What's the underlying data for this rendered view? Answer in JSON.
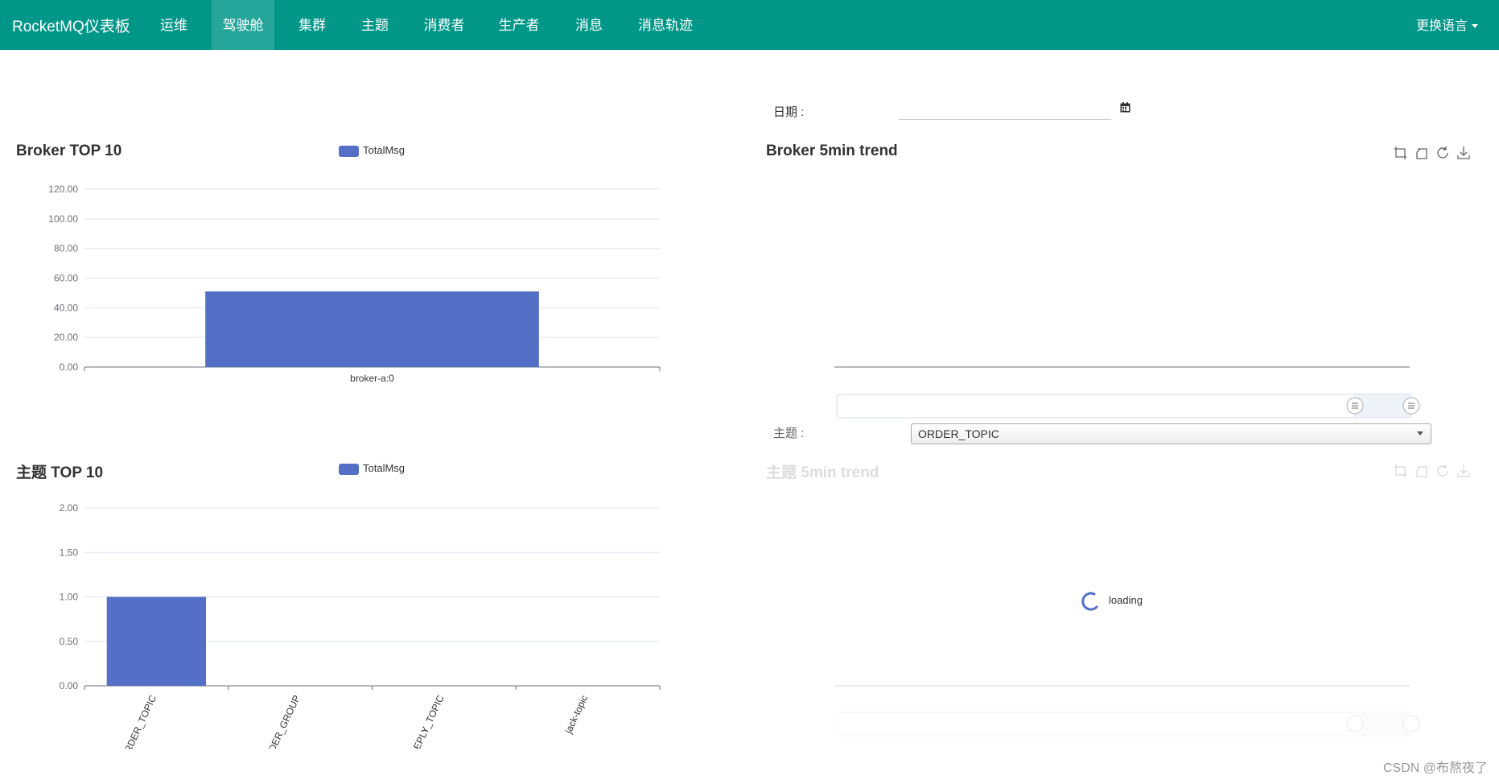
{
  "navbar": {
    "brand": "RocketMQ仪表板",
    "items": [
      {
        "label": "运维",
        "active": false
      },
      {
        "label": "驾驶舱",
        "active": true
      },
      {
        "label": "集群",
        "active": false
      },
      {
        "label": "主题",
        "active": false
      },
      {
        "label": "消费者",
        "active": false
      },
      {
        "label": "生产者",
        "active": false
      },
      {
        "label": "消息",
        "active": false
      },
      {
        "label": "消息轨迹",
        "active": false
      }
    ],
    "language_label": "更换语言"
  },
  "date_filter": {
    "label": "日期 :",
    "value": "",
    "calendar_icon": "calendar-icon"
  },
  "broker_top10": {
    "title": "Broker TOP 10",
    "legend": "TotalMsg",
    "legend_color": "#5470c6"
  },
  "broker_trend": {
    "title": "Broker 5min trend",
    "toolbox_icons": [
      "zoom-icon",
      "zoom-reset-icon",
      "restore-icon",
      "save-image-icon"
    ]
  },
  "topic_filter": {
    "label": "主题 :",
    "selected": "ORDER_TOPIC"
  },
  "topic_top10": {
    "title": "主题 TOP 10",
    "legend": "TotalMsg",
    "legend_color": "#5470c6"
  },
  "topic_trend": {
    "title": "主题 5min trend",
    "loading_text": "loading",
    "toolbox_icons": [
      "zoom-icon",
      "zoom-reset-icon",
      "restore-icon",
      "save-image-icon"
    ]
  },
  "watermark": "CSDN @布熬夜了",
  "chart_data": [
    {
      "type": "bar",
      "title": "Broker TOP 10",
      "series": [
        {
          "name": "TotalMsg",
          "values": [
            51
          ]
        }
      ],
      "categories": [
        "broker-a:0"
      ],
      "ylim": [
        0,
        120
      ],
      "yticks": [
        "0.00",
        "20.00",
        "40.00",
        "60.00",
        "80.00",
        "100.00",
        "120.00"
      ],
      "grid": true,
      "legend": "top-center",
      "color": "#5470c6"
    },
    {
      "type": "bar",
      "title": "主题 TOP 10",
      "series": [
        {
          "name": "TotalMsg",
          "values": [
            1,
            0,
            0,
            0
          ]
        }
      ],
      "categories": [
        "ORDER_TOPIC",
        "ORDER_GROUP",
        "REPLY_TOPIC",
        "jack-topic"
      ],
      "ylim": [
        0,
        2
      ],
      "yticks": [
        "0.00",
        "0.50",
        "1.00",
        "1.50",
        "2.00"
      ],
      "grid": true,
      "legend": "top-center",
      "color": "#5470c6"
    }
  ]
}
